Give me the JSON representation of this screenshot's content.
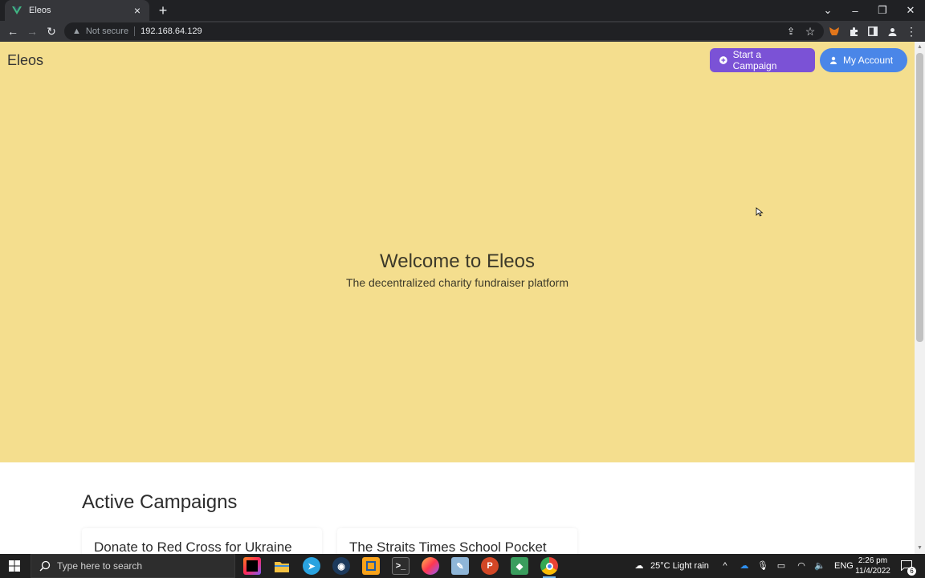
{
  "browser": {
    "tab_title": "Eleos",
    "security_label": "Not secure",
    "url": "192.168.64.129"
  },
  "page": {
    "brand": "Eleos",
    "start_campaign_label": "Start a Campaign",
    "my_account_label": "My Account",
    "hero_title": "Welcome to Eleos",
    "hero_subtitle": "The decentralized charity fundraiser platform",
    "section_title": "Active Campaigns",
    "campaigns": [
      {
        "title": "Donate to Red Cross for Ukraine"
      },
      {
        "title": "The Straits Times School Pocket"
      }
    ]
  },
  "taskbar": {
    "search_placeholder": "Type here to search",
    "weather": "25°C  Light rain",
    "language": "ENG",
    "time": "2:26 pm",
    "date": "11/4/2022",
    "notification_count": "6"
  },
  "colors": {
    "hero_bg": "#f4de8e",
    "campaign_button": "#7b52d6",
    "account_button": "#4a86e8"
  }
}
